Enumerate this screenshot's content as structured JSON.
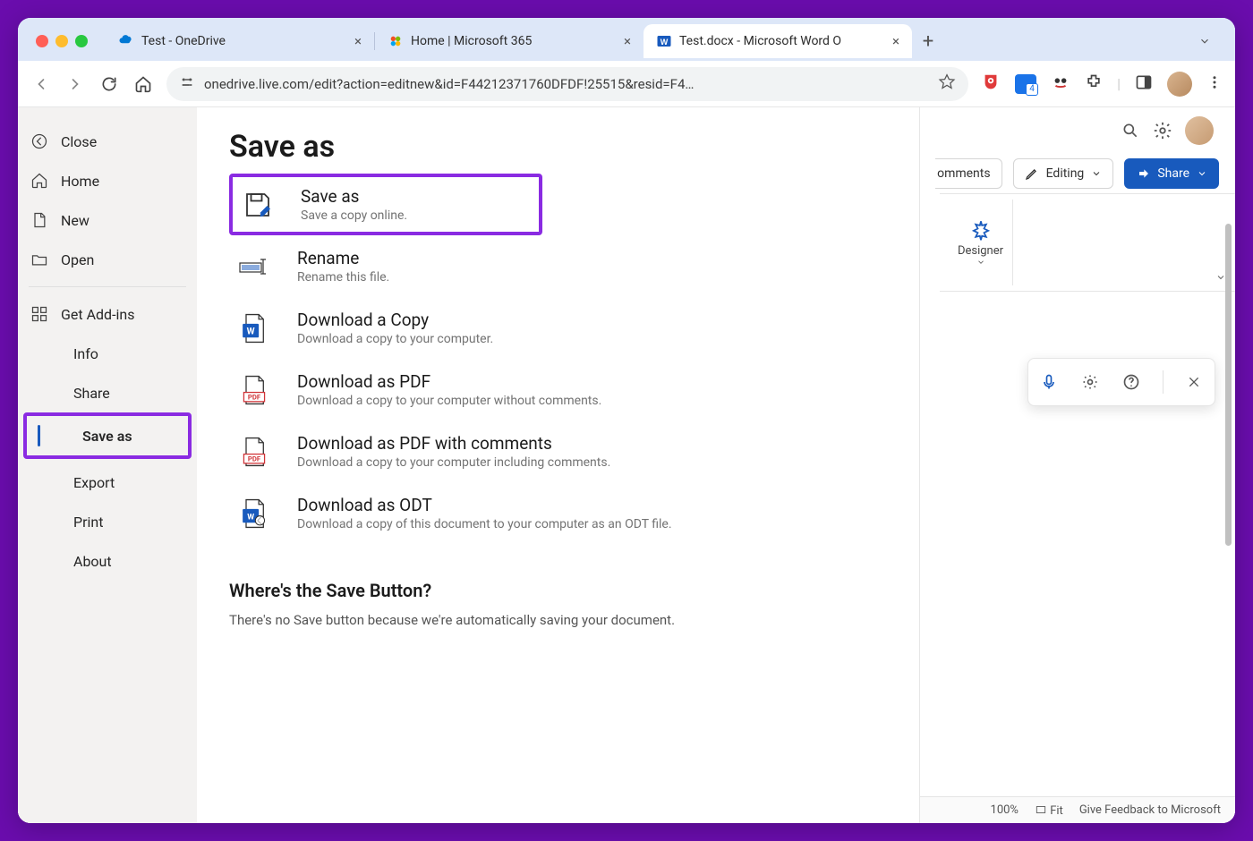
{
  "browser": {
    "tabs": [
      {
        "title": "Test - OneDrive",
        "favicon": "onedrive"
      },
      {
        "title": "Home | Microsoft 365",
        "favicon": "m365"
      },
      {
        "title": "Test.docx - Microsoft Word O",
        "favicon": "word",
        "active": true
      }
    ],
    "url": "onedrive.live.com/edit?action=editnew&id=F44212371760DFDF!25515&resid=F4…"
  },
  "ribbon": {
    "comments": "omments",
    "editing": "Editing",
    "share": "Share",
    "designer": "Designer"
  },
  "sidebar": {
    "close": "Close",
    "home": "Home",
    "new": "New",
    "open": "Open",
    "getaddins": "Get Add-ins",
    "info": "Info",
    "share": "Share",
    "saveas": "Save as",
    "export": "Export",
    "print": "Print",
    "about": "About"
  },
  "page": {
    "title": "Save as",
    "options": [
      {
        "title": "Save as",
        "sub": "Save a copy online."
      },
      {
        "title": "Rename",
        "sub": "Rename this file."
      },
      {
        "title": "Download a Copy",
        "sub": "Download a copy to your computer."
      },
      {
        "title": "Download as PDF",
        "sub": "Download a copy to your computer without comments."
      },
      {
        "title": "Download as PDF with comments",
        "sub": "Download a copy to your computer including comments."
      },
      {
        "title": "Download as ODT",
        "sub": "Download a copy of this document to your computer as an ODT file."
      }
    ],
    "where_title": "Where's the Save Button?",
    "where_body": "There's no Save button because we're automatically saving your document."
  },
  "status": {
    "zoom": "100%",
    "fit": "Fit",
    "feedback": "Give Feedback to Microsoft"
  }
}
